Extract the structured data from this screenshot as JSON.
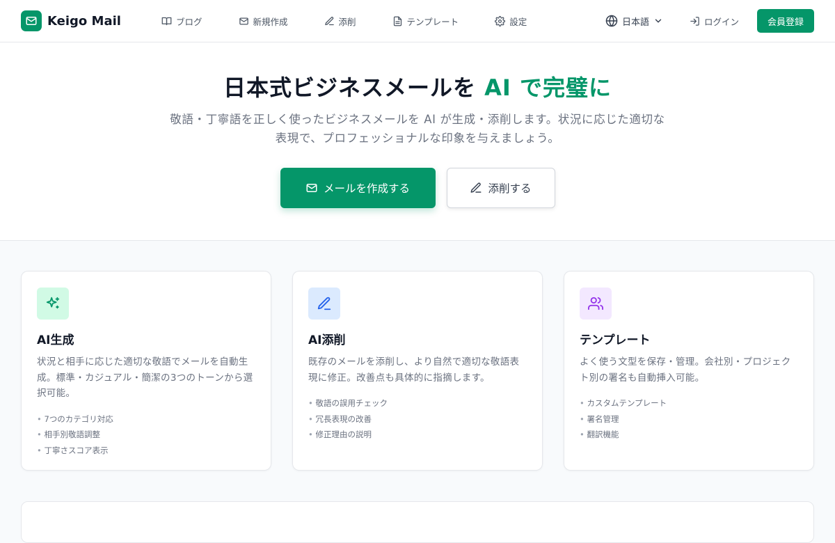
{
  "brand": {
    "name": "Keigo Mail",
    "logo_icon": "mail-icon",
    "logo_color": "#059669"
  },
  "nav": {
    "items": [
      {
        "label": "ブログ",
        "icon": "book-icon"
      },
      {
        "label": "新規作成",
        "icon": "mail-icon"
      },
      {
        "label": "添削",
        "icon": "pen-icon"
      },
      {
        "label": "テンプレート",
        "icon": "file-icon"
      },
      {
        "label": "設定",
        "icon": "gear-icon"
      }
    ]
  },
  "header_right": {
    "language": "日本語",
    "login": "ログイン",
    "signup": "会員登録"
  },
  "hero": {
    "title_main": "日本式ビジネスメールを ",
    "title_accent": "AI で完璧に",
    "subtitle": "敬語・丁寧語を正しく使ったビジネスメールを AI が生成・添削します。状況に応じた適切な表現で、プロフェッショナルな印象を与えましょう。",
    "primary_button": "メールを作成する",
    "secondary_button": "添削する"
  },
  "features": [
    {
      "title": "AI生成",
      "icon": "sparkles-icon",
      "icon_bg": "#d1fae5",
      "icon_color": "#059669",
      "description": "状況と相手に応じた適切な敬語でメールを自動生成。標準・カジュアル・簡潔の3つのトーンから選択可能。",
      "points": [
        "7つのカテゴリ対応",
        "相手別敬語調整",
        "丁寧さスコア表示"
      ]
    },
    {
      "title": "AI添削",
      "icon": "pen-icon",
      "icon_bg": "#dbeafe",
      "icon_color": "#2563eb",
      "description": "既存のメールを添削し、より自然で適切な敬語表現に修正。改善点も具体的に指摘します。",
      "points": [
        "敬語の誤用チェック",
        "冗長表現の改善",
        "修正理由の説明"
      ]
    },
    {
      "title": "テンプレート",
      "icon": "users-icon",
      "icon_bg": "#f3e8ff",
      "icon_color": "#9333ea",
      "description": "よく使う文型を保存・管理。会社別・プロジェクト別の署名も自動挿入可能。",
      "points": [
        "カスタムテンプレート",
        "署名管理",
        "翻訳機能"
      ]
    }
  ]
}
